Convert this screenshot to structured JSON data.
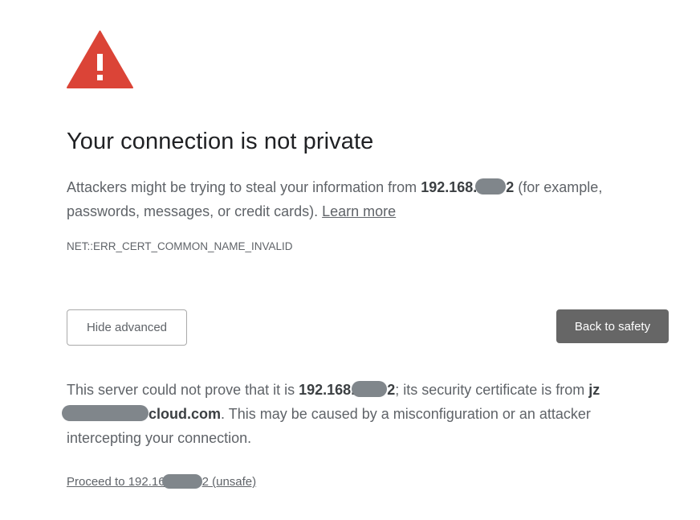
{
  "icon": {
    "name": "warning-triangle-icon",
    "color": "#db4437"
  },
  "title": "Your connection is not private",
  "main_message": {
    "prefix": "Attackers might be trying to steal your information from ",
    "host_start": "192.168.",
    "host_end": "2",
    "suffix": " (for example, passwords, messages, or credit cards). ",
    "learn_more": "Learn more"
  },
  "error_code": "NET::ERR_CERT_COMMON_NAME_INVALID",
  "buttons": {
    "hide_advanced": "Hide advanced",
    "back_to_safety": "Back to safety"
  },
  "details": {
    "prefix": "This server could not prove that it is ",
    "host_start": "192.168.",
    "host_end": "2",
    "middle": "; its security certificate is from ",
    "cert_start": "jz",
    "cert_end": "cloud.com",
    "suffix": ". This may be caused by a misconfiguration or an attacker intercepting your connection."
  },
  "proceed": {
    "start": "Proceed to 192.16",
    "end": "2 (unsafe)"
  },
  "colors": {
    "primary_button": "#666666",
    "text": "#5f6368",
    "redaction": "#80868b"
  }
}
